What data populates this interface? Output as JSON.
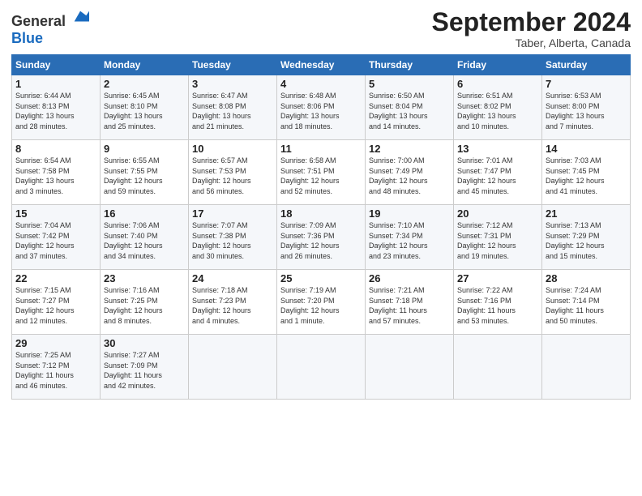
{
  "header": {
    "logo_general": "General",
    "logo_blue": "Blue",
    "month_year": "September 2024",
    "location": "Taber, Alberta, Canada"
  },
  "weekdays": [
    "Sunday",
    "Monday",
    "Tuesday",
    "Wednesday",
    "Thursday",
    "Friday",
    "Saturday"
  ],
  "weeks": [
    [
      {
        "day": 1,
        "detail": "Sunrise: 6:44 AM\nSunset: 8:13 PM\nDaylight: 13 hours\nand 28 minutes."
      },
      {
        "day": 2,
        "detail": "Sunrise: 6:45 AM\nSunset: 8:10 PM\nDaylight: 13 hours\nand 25 minutes."
      },
      {
        "day": 3,
        "detail": "Sunrise: 6:47 AM\nSunset: 8:08 PM\nDaylight: 13 hours\nand 21 minutes."
      },
      {
        "day": 4,
        "detail": "Sunrise: 6:48 AM\nSunset: 8:06 PM\nDaylight: 13 hours\nand 18 minutes."
      },
      {
        "day": 5,
        "detail": "Sunrise: 6:50 AM\nSunset: 8:04 PM\nDaylight: 13 hours\nand 14 minutes."
      },
      {
        "day": 6,
        "detail": "Sunrise: 6:51 AM\nSunset: 8:02 PM\nDaylight: 13 hours\nand 10 minutes."
      },
      {
        "day": 7,
        "detail": "Sunrise: 6:53 AM\nSunset: 8:00 PM\nDaylight: 13 hours\nand 7 minutes."
      }
    ],
    [
      {
        "day": 8,
        "detail": "Sunrise: 6:54 AM\nSunset: 7:58 PM\nDaylight: 13 hours\nand 3 minutes."
      },
      {
        "day": 9,
        "detail": "Sunrise: 6:55 AM\nSunset: 7:55 PM\nDaylight: 12 hours\nand 59 minutes."
      },
      {
        "day": 10,
        "detail": "Sunrise: 6:57 AM\nSunset: 7:53 PM\nDaylight: 12 hours\nand 56 minutes."
      },
      {
        "day": 11,
        "detail": "Sunrise: 6:58 AM\nSunset: 7:51 PM\nDaylight: 12 hours\nand 52 minutes."
      },
      {
        "day": 12,
        "detail": "Sunrise: 7:00 AM\nSunset: 7:49 PM\nDaylight: 12 hours\nand 48 minutes."
      },
      {
        "day": 13,
        "detail": "Sunrise: 7:01 AM\nSunset: 7:47 PM\nDaylight: 12 hours\nand 45 minutes."
      },
      {
        "day": 14,
        "detail": "Sunrise: 7:03 AM\nSunset: 7:45 PM\nDaylight: 12 hours\nand 41 minutes."
      }
    ],
    [
      {
        "day": 15,
        "detail": "Sunrise: 7:04 AM\nSunset: 7:42 PM\nDaylight: 12 hours\nand 37 minutes."
      },
      {
        "day": 16,
        "detail": "Sunrise: 7:06 AM\nSunset: 7:40 PM\nDaylight: 12 hours\nand 34 minutes."
      },
      {
        "day": 17,
        "detail": "Sunrise: 7:07 AM\nSunset: 7:38 PM\nDaylight: 12 hours\nand 30 minutes."
      },
      {
        "day": 18,
        "detail": "Sunrise: 7:09 AM\nSunset: 7:36 PM\nDaylight: 12 hours\nand 26 minutes."
      },
      {
        "day": 19,
        "detail": "Sunrise: 7:10 AM\nSunset: 7:34 PM\nDaylight: 12 hours\nand 23 minutes."
      },
      {
        "day": 20,
        "detail": "Sunrise: 7:12 AM\nSunset: 7:31 PM\nDaylight: 12 hours\nand 19 minutes."
      },
      {
        "day": 21,
        "detail": "Sunrise: 7:13 AM\nSunset: 7:29 PM\nDaylight: 12 hours\nand 15 minutes."
      }
    ],
    [
      {
        "day": 22,
        "detail": "Sunrise: 7:15 AM\nSunset: 7:27 PM\nDaylight: 12 hours\nand 12 minutes."
      },
      {
        "day": 23,
        "detail": "Sunrise: 7:16 AM\nSunset: 7:25 PM\nDaylight: 12 hours\nand 8 minutes."
      },
      {
        "day": 24,
        "detail": "Sunrise: 7:18 AM\nSunset: 7:23 PM\nDaylight: 12 hours\nand 4 minutes."
      },
      {
        "day": 25,
        "detail": "Sunrise: 7:19 AM\nSunset: 7:20 PM\nDaylight: 12 hours\nand 1 minute."
      },
      {
        "day": 26,
        "detail": "Sunrise: 7:21 AM\nSunset: 7:18 PM\nDaylight: 11 hours\nand 57 minutes."
      },
      {
        "day": 27,
        "detail": "Sunrise: 7:22 AM\nSunset: 7:16 PM\nDaylight: 11 hours\nand 53 minutes."
      },
      {
        "day": 28,
        "detail": "Sunrise: 7:24 AM\nSunset: 7:14 PM\nDaylight: 11 hours\nand 50 minutes."
      }
    ],
    [
      {
        "day": 29,
        "detail": "Sunrise: 7:25 AM\nSunset: 7:12 PM\nDaylight: 11 hours\nand 46 minutes."
      },
      {
        "day": 30,
        "detail": "Sunrise: 7:27 AM\nSunset: 7:09 PM\nDaylight: 11 hours\nand 42 minutes."
      },
      null,
      null,
      null,
      null,
      null
    ]
  ]
}
